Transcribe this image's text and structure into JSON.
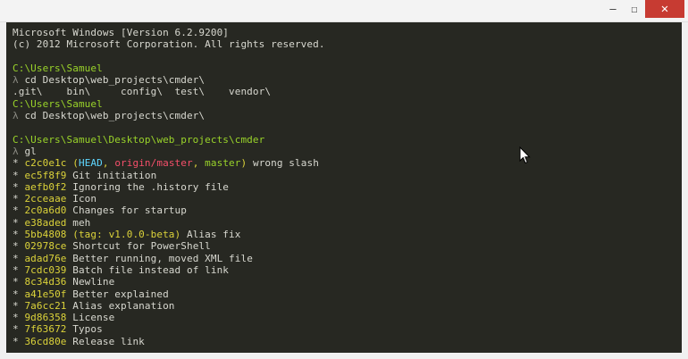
{
  "window": {
    "controls": {
      "minimize": "—",
      "maximize": "☐",
      "close": "✕"
    }
  },
  "console": {
    "lines": [
      {
        "id": "banner1",
        "segs": [
          {
            "t": "Microsoft Windows [Version 6.2.9200]",
            "c": "w"
          }
        ]
      },
      {
        "id": "banner2",
        "segs": [
          {
            "t": "(c) 2012 Microsoft Corporation. All rights reserved.",
            "c": "w"
          }
        ]
      },
      {
        "id": "blank1",
        "segs": []
      },
      {
        "id": "path1",
        "segs": [
          {
            "t": "C:\\Users\\Samuel",
            "c": "g"
          }
        ]
      },
      {
        "id": "cmd1",
        "segs": [
          {
            "t": "λ ",
            "c": "dim"
          },
          {
            "t": "cd Desktop\\web_projects\\cmder\\",
            "c": "w"
          }
        ]
      },
      {
        "id": "ls1",
        "segs": [
          {
            "t": ".git\\    bin\\     config\\  test\\    vendor\\",
            "c": "w"
          }
        ]
      },
      {
        "id": "path2",
        "segs": [
          {
            "t": "C:\\Users\\Samuel",
            "c": "g"
          }
        ]
      },
      {
        "id": "cmd2",
        "segs": [
          {
            "t": "λ ",
            "c": "dim"
          },
          {
            "t": "cd Desktop\\web_projects\\cmder\\",
            "c": "w"
          }
        ]
      },
      {
        "id": "blank2",
        "segs": []
      },
      {
        "id": "path3",
        "segs": [
          {
            "t": "C:\\Users\\Samuel\\Desktop\\web_projects\\cmder",
            "c": "g"
          }
        ]
      },
      {
        "id": "cmd3",
        "segs": [
          {
            "t": "λ ",
            "c": "dim"
          },
          {
            "t": "gl",
            "c": "w"
          }
        ]
      },
      {
        "id": "log1",
        "segs": [
          {
            "t": "* ",
            "c": "w"
          },
          {
            "t": "c2c0e1c",
            "c": "y"
          },
          {
            "t": " (",
            "c": "y"
          },
          {
            "t": "HEAD",
            "c": "c"
          },
          {
            "t": ", ",
            "c": "y"
          },
          {
            "t": "origin/master",
            "c": "r"
          },
          {
            "t": ", ",
            "c": "y"
          },
          {
            "t": "master",
            "c": "g"
          },
          {
            "t": ")",
            "c": "y"
          },
          {
            "t": " wrong slash",
            "c": "w"
          }
        ]
      },
      {
        "id": "log2",
        "segs": [
          {
            "t": "* ",
            "c": "w"
          },
          {
            "t": "ec5f8f9",
            "c": "y"
          },
          {
            "t": " Git initiation",
            "c": "w"
          }
        ]
      },
      {
        "id": "log3",
        "segs": [
          {
            "t": "* ",
            "c": "w"
          },
          {
            "t": "aefb0f2",
            "c": "y"
          },
          {
            "t": " Ignoring the .history file",
            "c": "w"
          }
        ]
      },
      {
        "id": "log4",
        "segs": [
          {
            "t": "* ",
            "c": "w"
          },
          {
            "t": "2cceaae",
            "c": "y"
          },
          {
            "t": " Icon",
            "c": "w"
          }
        ]
      },
      {
        "id": "log5",
        "segs": [
          {
            "t": "* ",
            "c": "w"
          },
          {
            "t": "2c0a6d0",
            "c": "y"
          },
          {
            "t": " Changes for startup",
            "c": "w"
          }
        ]
      },
      {
        "id": "log6",
        "segs": [
          {
            "t": "* ",
            "c": "w"
          },
          {
            "t": "e38aded",
            "c": "y"
          },
          {
            "t": " meh",
            "c": "w"
          }
        ]
      },
      {
        "id": "log7",
        "segs": [
          {
            "t": "* ",
            "c": "w"
          },
          {
            "t": "5bb4808",
            "c": "y"
          },
          {
            "t": " (tag: v1.0.0-beta)",
            "c": "y"
          },
          {
            "t": " Alias fix",
            "c": "w"
          }
        ]
      },
      {
        "id": "log8",
        "segs": [
          {
            "t": "* ",
            "c": "w"
          },
          {
            "t": "02978ce",
            "c": "y"
          },
          {
            "t": " Shortcut for PowerShell",
            "c": "w"
          }
        ]
      },
      {
        "id": "log9",
        "segs": [
          {
            "t": "* ",
            "c": "w"
          },
          {
            "t": "adad76e",
            "c": "y"
          },
          {
            "t": " Better running, moved XML file",
            "c": "w"
          }
        ]
      },
      {
        "id": "log10",
        "segs": [
          {
            "t": "* ",
            "c": "w"
          },
          {
            "t": "7cdc039",
            "c": "y"
          },
          {
            "t": " Batch file instead of link",
            "c": "w"
          }
        ]
      },
      {
        "id": "log11",
        "segs": [
          {
            "t": "* ",
            "c": "w"
          },
          {
            "t": "8c34d36",
            "c": "y"
          },
          {
            "t": " Newline",
            "c": "w"
          }
        ]
      },
      {
        "id": "log12",
        "segs": [
          {
            "t": "* ",
            "c": "w"
          },
          {
            "t": "a41e50f",
            "c": "y"
          },
          {
            "t": " Better explained",
            "c": "w"
          }
        ]
      },
      {
        "id": "log13",
        "segs": [
          {
            "t": "* ",
            "c": "w"
          },
          {
            "t": "7a6cc21",
            "c": "y"
          },
          {
            "t": " Alias explanation",
            "c": "w"
          }
        ]
      },
      {
        "id": "log14",
        "segs": [
          {
            "t": "* ",
            "c": "w"
          },
          {
            "t": "9d86358",
            "c": "y"
          },
          {
            "t": " License",
            "c": "w"
          }
        ]
      },
      {
        "id": "log15",
        "segs": [
          {
            "t": "* ",
            "c": "w"
          },
          {
            "t": "7f63672",
            "c": "y"
          },
          {
            "t": " Typos",
            "c": "w"
          }
        ]
      },
      {
        "id": "log16",
        "segs": [
          {
            "t": "* ",
            "c": "w"
          },
          {
            "t": "36cd80e",
            "c": "y"
          },
          {
            "t": " Release link",
            "c": "w"
          }
        ]
      }
    ]
  },
  "colors": {
    "background": "#272822",
    "text": "#d8d8d0",
    "path_green": "#9ad42a",
    "hash_yellow": "#dcd33a",
    "head_cyan": "#5fd7ff",
    "origin_red": "#f54f6a",
    "close_button": "#c73b32"
  },
  "icons": {
    "minimize": "minimize-icon",
    "maximize": "maximize-icon",
    "close": "close-icon",
    "cursor": "mouse-pointer-icon"
  }
}
